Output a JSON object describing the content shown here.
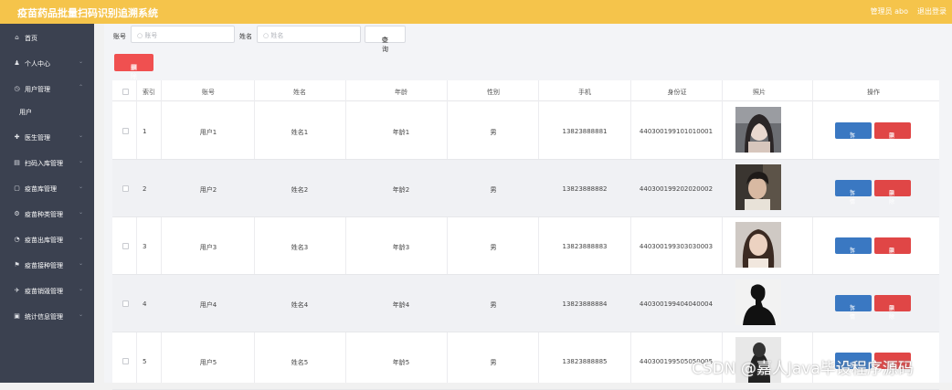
{
  "header": {
    "title": "疫苗药品批量扫码识别追溯系统",
    "admin": "管理员 abo",
    "logout": "退出登录"
  },
  "sidebar": {
    "items": [
      {
        "icon": "home-icon",
        "label": "首页",
        "chevron": ""
      },
      {
        "icon": "user-icon",
        "label": "个人中心",
        "chevron": "⌄"
      },
      {
        "icon": "clock-icon",
        "label": "用户管理",
        "chevron": "⌃"
      },
      {
        "icon": "",
        "label": "用户",
        "chevron": ""
      },
      {
        "icon": "doctor-icon",
        "label": "医生管理",
        "chevron": "⌄"
      },
      {
        "icon": "barcode-icon",
        "label": "扫码入库管理",
        "chevron": "⌄"
      },
      {
        "icon": "box-icon",
        "label": "疫苗库管理",
        "chevron": "⌄"
      },
      {
        "icon": "gear-icon",
        "label": "疫苗种类管理",
        "chevron": "⌄"
      },
      {
        "icon": "export-icon",
        "label": "疫苗出库管理",
        "chevron": "⌄"
      },
      {
        "icon": "flag-icon",
        "label": "疫苗接种管理",
        "chevron": "⌄"
      },
      {
        "icon": "plane-icon",
        "label": "疫苗销毁管理",
        "chevron": "⌄"
      },
      {
        "icon": "chart-icon",
        "label": "统计信息管理",
        "chevron": "⌄"
      }
    ]
  },
  "search": {
    "account_label": "账号",
    "account_placeholder": "账号",
    "name_label": "姓名",
    "name_placeholder": "姓名",
    "query_button": "查询",
    "delete_button": "删除"
  },
  "table": {
    "columns": [
      "索引",
      "账号",
      "姓名",
      "年龄",
      "性别",
      "手机",
      "身份证",
      "照片",
      "操作"
    ],
    "detail_label": "详情",
    "delete_label": "删除",
    "rows": [
      {
        "index": "1",
        "account": "用户1",
        "name": "姓名1",
        "age": "年龄1",
        "gender": "男",
        "phone": "13823888881",
        "id_card": "440300199101010001"
      },
      {
        "index": "2",
        "account": "用户2",
        "name": "姓名2",
        "age": "年龄2",
        "gender": "男",
        "phone": "13823888882",
        "id_card": "440300199202020002"
      },
      {
        "index": "3",
        "account": "用户3",
        "name": "姓名3",
        "age": "年龄3",
        "gender": "男",
        "phone": "13823888883",
        "id_card": "440300199303030003"
      },
      {
        "index": "4",
        "account": "用户4",
        "name": "姓名4",
        "age": "年龄4",
        "gender": "男",
        "phone": "13823888884",
        "id_card": "440300199404040004"
      },
      {
        "index": "5",
        "account": "用户5",
        "name": "姓名5",
        "age": "年龄5",
        "gender": "男",
        "phone": "13823888885",
        "id_card": "440300199505050005"
      }
    ]
  },
  "watermark": "CSDN @嘉人Java毕设程序源码",
  "colors": {
    "header": "#f5c44b",
    "sidebar": "#3b4150",
    "detail_button": "#3a78c2",
    "delete_button": "#e04646"
  }
}
